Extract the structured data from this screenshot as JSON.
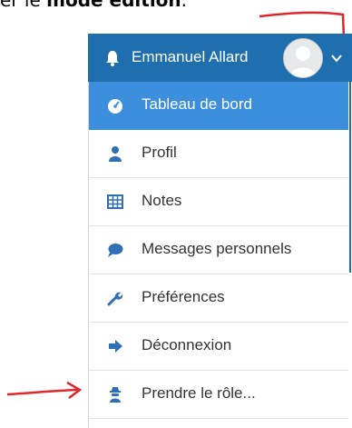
{
  "caption": {
    "prefix": "er le ",
    "bold": "mode édition",
    "suffix": "."
  },
  "topbar": {
    "username": "Emmanuel Allard"
  },
  "menu": {
    "items": [
      {
        "label": "Tableau de bord",
        "icon": "dashboard-icon",
        "active": true
      },
      {
        "label": "Profil",
        "icon": "user-icon"
      },
      {
        "label": "Notes",
        "icon": "grid-icon"
      },
      {
        "label": "Messages personnels",
        "icon": "speech-bubble-icon"
      },
      {
        "label": "Préférences",
        "icon": "wrench-icon"
      },
      {
        "label": "Déconnexion",
        "icon": "sign-out-icon"
      },
      {
        "label": "Prendre le rôle...",
        "icon": "user-secret-icon"
      }
    ]
  },
  "colors": {
    "header": "#1f6fae",
    "active": "#3c8fdc",
    "annotation": "#e0272b"
  }
}
